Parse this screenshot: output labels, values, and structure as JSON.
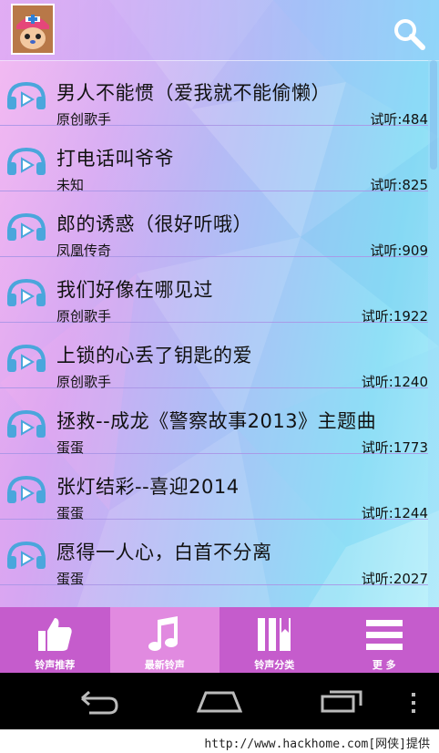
{
  "header": {
    "avatar_icon": "chopper-avatar-icon",
    "search_icon": "search-icon"
  },
  "songs": [
    {
      "title": "男人不能惯（爱我就不能偷懒）",
      "artist": "原创歌手",
      "plays": "试听:484"
    },
    {
      "title": "打电话叫爷爷",
      "artist": "未知",
      "plays": "试听:825"
    },
    {
      "title": "郎的诱惑（很好听哦）",
      "artist": "凤凰传奇",
      "plays": "试听:909"
    },
    {
      "title": "我们好像在哪见过",
      "artist": "原创歌手",
      "plays": "试听:1922"
    },
    {
      "title": "上锁的心丢了钥匙的爱",
      "artist": "原创歌手",
      "plays": "试听:1240"
    },
    {
      "title": "拯救--成龙《警察故事2013》主题曲",
      "artist": "蛋蛋",
      "plays": "试听:1773"
    },
    {
      "title": "张灯结彩--喜迎2014",
      "artist": "蛋蛋",
      "plays": "试听:1244"
    },
    {
      "title": "愿得一人心，白首不分离",
      "artist": "蛋蛋",
      "plays": "试听:2027"
    }
  ],
  "tabs": [
    {
      "label": "铃声推荐",
      "icon": "thumbs-up-icon"
    },
    {
      "label": "最新铃声",
      "icon": "music-note-icon"
    },
    {
      "label": "铃声分类",
      "icon": "category-book-icon"
    },
    {
      "label": "更 多",
      "icon": "menu-icon"
    }
  ],
  "navbar": {
    "back": "back-icon",
    "home": "home-icon",
    "recents": "recents-icon",
    "overflow": "overflow-icon"
  },
  "footer": {
    "text": "http://www.hackhome.com[网侠]提供"
  },
  "colors": {
    "tabbar": "#c55ccc",
    "tab_active": "#e18ae0",
    "speaker_icon": "#4aa6dc"
  }
}
